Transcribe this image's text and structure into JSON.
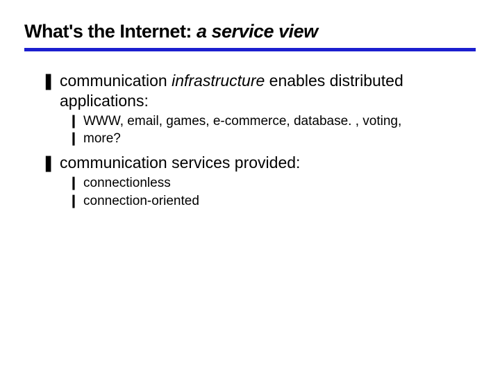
{
  "title": {
    "plain": "What's the Internet: ",
    "italic": "a service view"
  },
  "bullets": [
    {
      "marker": "❚",
      "segments": [
        {
          "text": "communication ",
          "style": "plain"
        },
        {
          "text": "infrastructure",
          "style": "italic"
        },
        {
          "text": " enables distributed applications:",
          "style": "plain"
        }
      ],
      "children": [
        {
          "marker": "❙",
          "text": "WWW, email, games, e-commerce, database. , voting,"
        },
        {
          "marker": "❙",
          "text": "more?"
        }
      ]
    },
    {
      "marker": "❚",
      "segments": [
        {
          "text": "communication services provided:",
          "style": "plain"
        }
      ],
      "children": [
        {
          "marker": "❙",
          "text": "connectionless"
        },
        {
          "marker": "❙",
          "text": "connection-oriented"
        }
      ]
    }
  ]
}
